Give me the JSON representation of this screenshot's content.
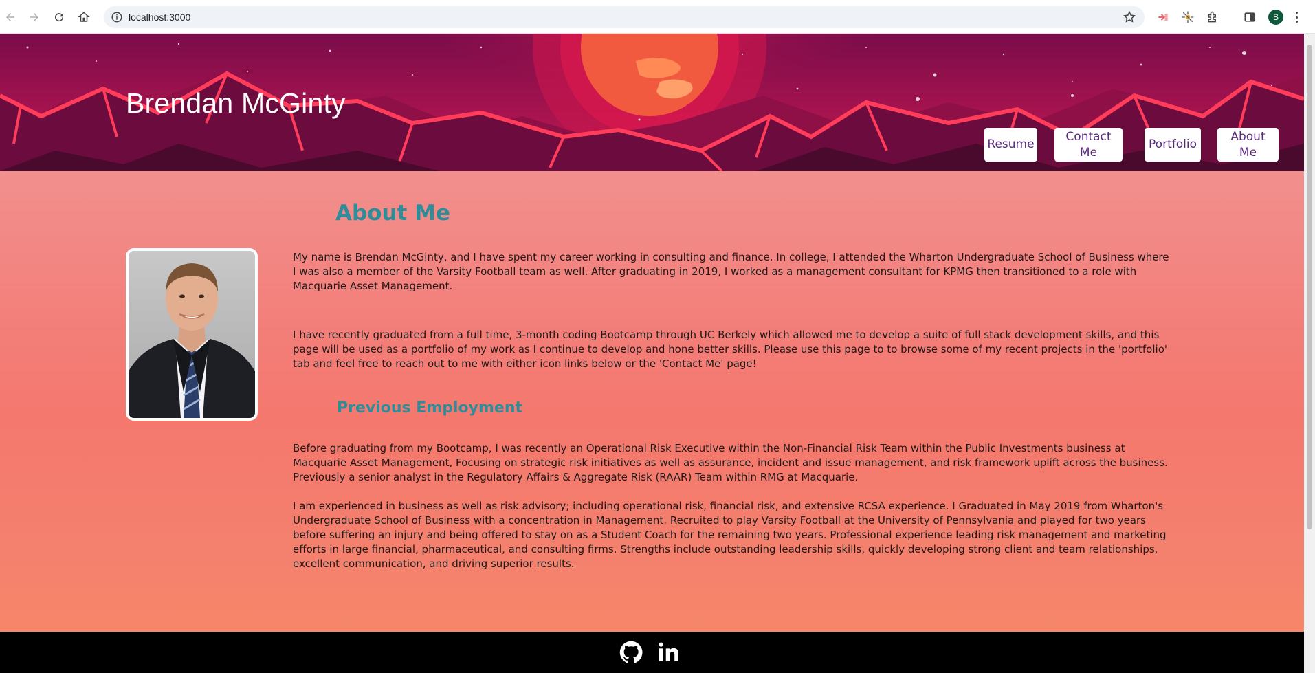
{
  "browser": {
    "url": "localhost:3000",
    "profile_initial": "B",
    "icons": [
      "back-icon",
      "forward-icon",
      "reload-icon",
      "home-icon",
      "site-info-icon",
      "bookmark-star-icon",
      "extension-icon",
      "puzzle-icon",
      "side-panel-icon",
      "more-icon"
    ]
  },
  "header": {
    "title": "Brendan McGinty",
    "nav": [
      {
        "label": "Resume"
      },
      {
        "label": "Contact Me"
      },
      {
        "label": "Portfolio"
      },
      {
        "label": "About Me"
      }
    ]
  },
  "about": {
    "heading": "About Me",
    "photo_alt": "Portrait of Brendan McGinty",
    "paragraphs": [
      "My name is Brendan McGinty, and I have spent my career working in consulting and finance. In college, I attended the Wharton Undergraduate School of Business where I was also a member of the Varsity Football team as well. After graduating in 2019, I worked as a management consultant for KPMG then transitioned to a role with Macquarie Asset Management.",
      "I have recently graduated from a full time, 3-month coding Bootcamp through UC Berkely which allowed me to develop a suite of full stack development skills, and this page will be used as a portfolio of my work as I continue to develop and hone better skills. Please use this page to to browse some of my recent projects in the 'portfolio' tab and feel free to reach out to me with either icon links below or the 'Contact Me' page!"
    ]
  },
  "employment": {
    "heading": "Previous Employment",
    "paragraphs": [
      "Before graduating from my Bootcamp, I was recently an Operational Risk Executive within the Non-Financial Risk Team within the Public Investments business at Macquarie Asset Management, Focusing on strategic risk initiatives as well as assurance, incident and issue management, and risk framework uplift across the business. Previously a senior analyst in the Regulatory Affairs & Aggregate Risk (RAAR) Team within RMG at Macquarie.",
      "I am experienced in business as well as risk advisory; including operational risk, financial risk, and extensive RCSA experience. I Graduated in May 2019 from Wharton's Undergraduate School of Business with a concentration in Management. Recruited to play Varsity Football at the University of Pennsylvania and played for two years before suffering an injury and being offered to stay on as a Student Coach for the remaining two years. Professional experience leading risk management and marketing efforts in large financial, pharmaceutical, and consulting firms. Strengths include outstanding leadership skills, quickly developing strong client and team relationships, excellent communication, and driving superior results."
    ]
  },
  "footer": {
    "links": [
      {
        "icon": "github-icon"
      },
      {
        "icon": "linkedin-icon"
      }
    ]
  },
  "colors": {
    "heading": "#2f8d9a",
    "nav_text": "#5a2a7e",
    "footer_bg": "#000000"
  }
}
